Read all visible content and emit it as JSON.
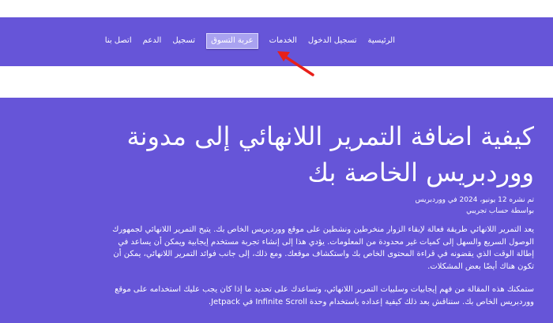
{
  "nav": {
    "items": [
      {
        "label": "الرئيسية",
        "active": false
      },
      {
        "label": "تسجيل الدخول",
        "active": false
      },
      {
        "label": "الخدمات",
        "active": false
      },
      {
        "label": "عربة التسوق",
        "active": true
      },
      {
        "label": "تسجيل",
        "active": false
      },
      {
        "label": "الدعم",
        "active": false
      },
      {
        "label": "اتصل بنا",
        "active": false
      }
    ]
  },
  "article": {
    "title": "كيفية اضافة التمرير اللانهائي إلى مدونة ووردبريس الخاصة بك",
    "date_line": "تم نشره 12 يونيو، 2024 في ووردبريس",
    "author_line": "بواسطة حساب تجريبي",
    "paragraphs": [
      "يعد التمرير اللانهائي طريقة فعالة لإبقاء الزوار منخرطين ونشطين على موقع ووردبريس الخاص بك. يتيح التمرير اللانهائي لجمهورك الوصول السريع والسهل إلى كميات غير محدودة من المعلومات. يؤدي هذا إلى إنشاء تجربة مستخدم إيجابية ويمكن أن يساعد في إطالة الوقت الذي يقضونه في قراءة المحتوى الخاص بك واستكشاف موقعك. ومع ذلك، إلى جانب فوائد التمرير اللانهائي، يمكن أن تكون هناك أيضًا بعض المشكلات.",
      "ستمكنك هذه المقالة من فهم إيجابيات وسلبيات التمرير اللانهائي، وتساعدك على تحديد ما إذا كان يجب عليك استخدامه على موقع ووردبريس الخاص بك. سنناقش بعد ذلك كيفية إعداده باستخدام وحدة Infinite Scroll في Jetpack."
    ]
  },
  "colors": {
    "brand_purple": "#6655d8",
    "active_tab": "#a9a2f0",
    "annotation_arrow": "#e8201a"
  }
}
